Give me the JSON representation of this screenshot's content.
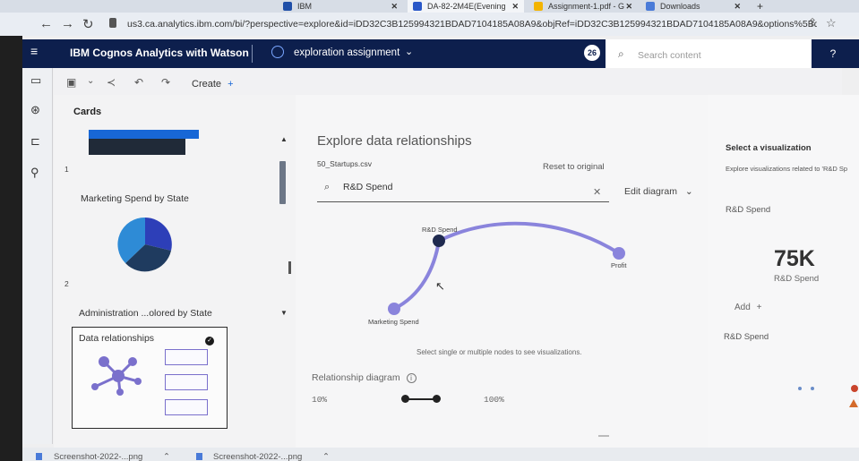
{
  "browser": {
    "tabs": [
      {
        "label": "IBM"
      },
      {
        "label": "DA-82-2M4E(Evening"
      },
      {
        "label": "Assignment-1.pdf - G"
      },
      {
        "label": "Downloads"
      }
    ],
    "new_tab": "+",
    "url": "us3.ca.analytics.ibm.com/bi/?perspective=explore&id=iDD32C3B125994321BDAD7104185A08A9&objRef=iDD32C3B125994321BDAD7104185A08A9&options%5Bdisab..."
  },
  "header": {
    "app_title": "IBM Cognos Analytics with Watson",
    "exploration_name": "exploration assignment",
    "notification_count": "26",
    "search_placeholder": "Search content",
    "help_icon": "?"
  },
  "toolbar": {
    "create_label": "Create",
    "create_plus": "+"
  },
  "cards_panel": {
    "title": "Cards",
    "items": [
      {
        "index": "1",
        "label": "Marketing Spend by State"
      },
      {
        "index": "2",
        "label": "Administration ...olored by State"
      },
      {
        "label": "Data relationships"
      }
    ]
  },
  "main": {
    "title": "Explore data relationships",
    "dataset": "50_Startups.csv",
    "reset_label": "Reset to original",
    "search_value": "R&D Spend",
    "edit_diagram": "Edit diagram",
    "nodes": {
      "rd": "R&D Spend",
      "profit": "Profit",
      "marketing": "Marketing Spend"
    },
    "hint": "Select single or multiple nodes to see visualizations.",
    "relationship_label": "Relationship diagram",
    "range_min": "10%",
    "range_max": "100%"
  },
  "right_panel": {
    "title": "Select a visualization",
    "subtitle": "Explore visualizations related to 'R&D Sp",
    "field_label": "R&D Spend",
    "kpi_value": "75K",
    "kpi_label": "R&D Spend",
    "add_label": "Add",
    "add_plus": "+",
    "field_label2": "R&D Spend"
  },
  "downloads": [
    {
      "label": "Screenshot-2022-...png"
    },
    {
      "label": "Screenshot-2022-...png"
    }
  ],
  "colors": {
    "header": "#0d1f4d",
    "accent_blue": "#1867d6",
    "node_purple": "#8a84dc",
    "node_dark": "#1f2a4f"
  }
}
